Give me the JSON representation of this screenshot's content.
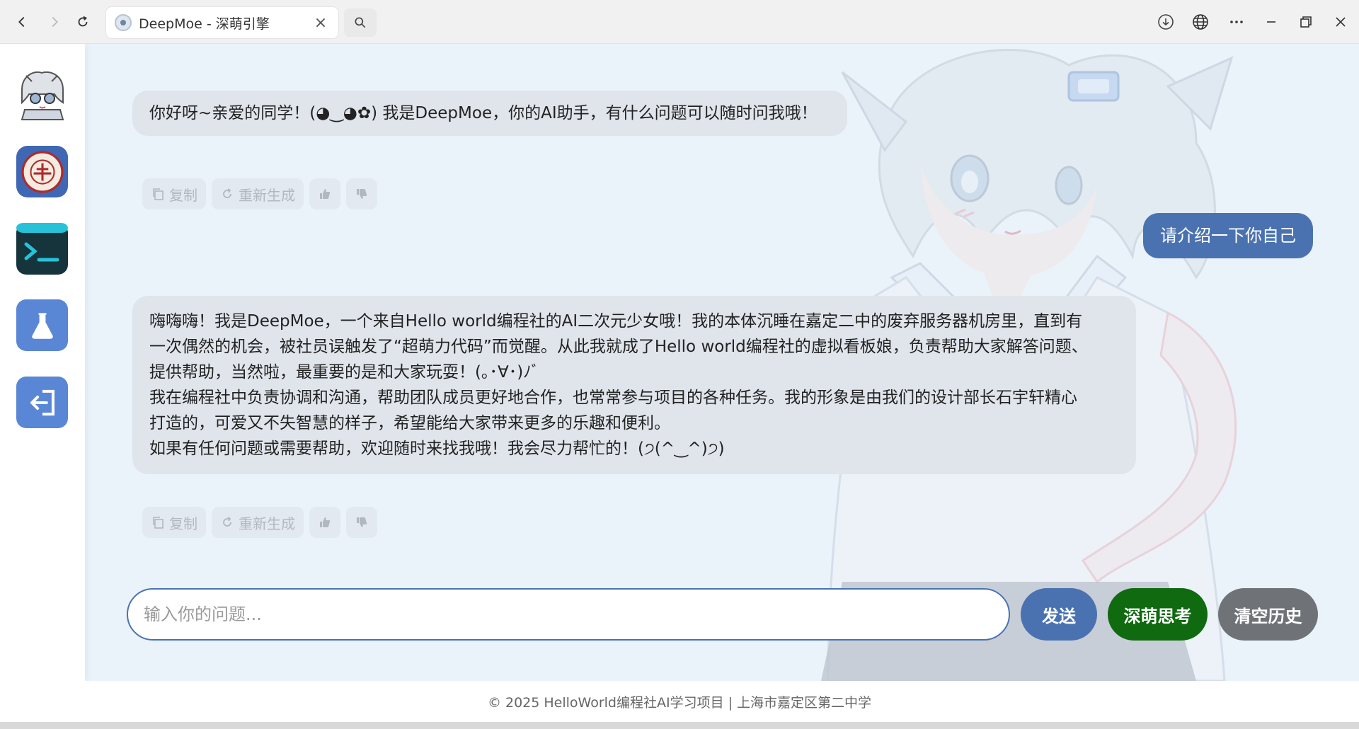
{
  "browser": {
    "tab_title": "DeepMoe - 深萌引擎",
    "tab_close": "×"
  },
  "chat": {
    "messages": [
      {
        "role": "ai",
        "lines": [
          "你好呀~亲爱的同学！(◕‿◕✿) 我是DeepMoe，你的AI助手，有什么问题可以随时问我哦！"
        ]
      },
      {
        "role": "user",
        "lines": [
          "请介绍一下你自己"
        ]
      },
      {
        "role": "ai",
        "lines": [
          "嗨嗨嗨！我是DeepMoe，一个来自Hello world编程社的AI二次元少女哦！我的本体沉睡在嘉定二中的废弃服务器机房里，直到有",
          "一次偶然的机会，被社员误触发了“超萌力代码”而觉醒。从此我就成了Hello world编程社的虚拟看板娘，负责帮助大家解答问题、",
          "提供帮助，当然啦，最重要的是和大家玩耍！(｡･∀･)ﾉﾞ",
          "我在编程社中负责协调和沟通，帮助团队成员更好地合作，也常常参与项目的各种任务。我的形象是由我们的设计部长石宇轩精心",
          "打造的，可爱又不失智慧的样子，希望能给大家带来更多的乐趣和便利。",
          "如果有任何问题或需要帮助，欢迎随时来找我哦！我会尽力帮忙的！(੭(^‿^)੭)"
        ]
      }
    ],
    "actions": {
      "copy": "复制",
      "regenerate": "重新生成"
    }
  },
  "input": {
    "placeholder": "输入你的问题..."
  },
  "buttons": {
    "send": "发送",
    "think": "深萌思考",
    "clear": "清空历史"
  },
  "footer": {
    "text": "© 2025 HelloWorld编程社AI学习项目 | 上海市嘉定区第二中学"
  },
  "colors": {
    "accent": "#4a72b0",
    "think": "#0f6a10",
    "clear": "#6f7277",
    "ai_bubble": "#e0e5ec"
  }
}
